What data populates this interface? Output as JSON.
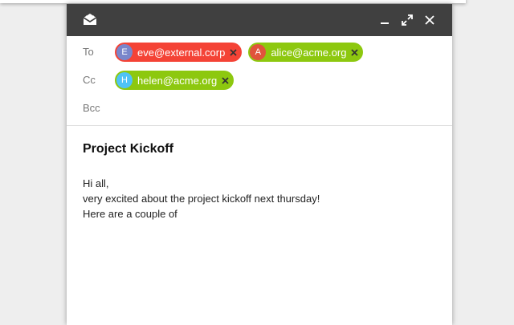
{
  "compose": {
    "header": {
      "icons": {
        "mail": "mail-open-icon",
        "minimize": "minimize-icon",
        "maximize": "expand-icon",
        "close": "close-icon"
      },
      "color": "#404040"
    },
    "fields": {
      "to": {
        "label": "To",
        "recipients": [
          {
            "initial": "E",
            "email": "eve@external.corp",
            "chip_color": "#f44336",
            "avatar_color": "#7986cb"
          },
          {
            "initial": "A",
            "email": "alice@acme.org",
            "chip_color": "#8dc80f",
            "avatar_color": "#e0533c"
          }
        ]
      },
      "cc": {
        "label": "Cc",
        "recipients": [
          {
            "initial": "H",
            "email": "helen@acme.org",
            "chip_color": "#8dc80f",
            "avatar_color": "#4fc3f7"
          }
        ]
      },
      "bcc": {
        "label": "Bcc",
        "value": ""
      }
    },
    "subject": "Project Kickoff",
    "body_lines": [
      "Hi all,",
      "very excited about the project kickoff next thursday!",
      "Here are a couple of"
    ]
  }
}
